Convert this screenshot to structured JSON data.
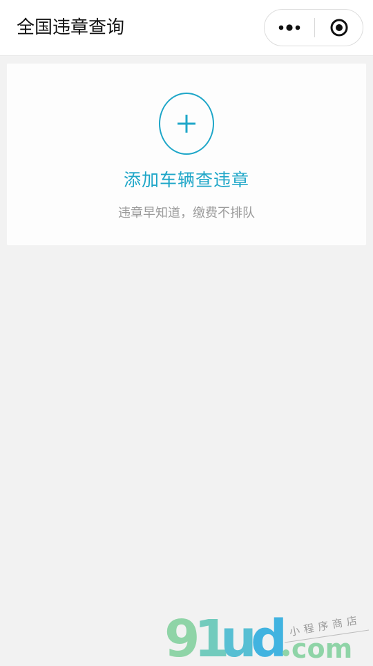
{
  "header": {
    "title": "全国违章查询",
    "more_icon": "more-dots-icon",
    "close_icon": "target-close-icon"
  },
  "card": {
    "add_icon": "plus-circle-icon",
    "add_label": "添加车辆查违章",
    "subtitle": "违章早知道，缴费不排队",
    "accent_color": "#1ea6c8"
  },
  "watermark": {
    "brand": "91ud.com",
    "tagline": "小程序商店"
  }
}
